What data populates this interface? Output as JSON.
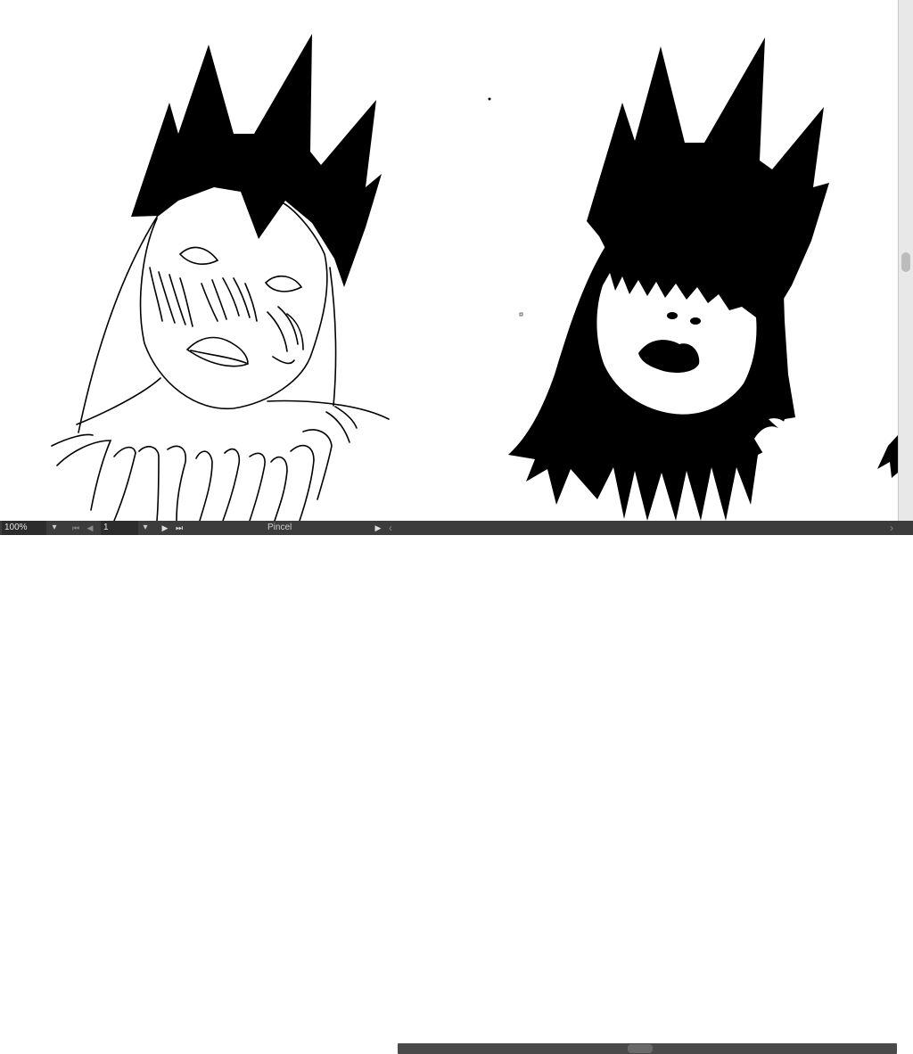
{
  "status_bar": {
    "zoom_value": "100%",
    "zoom_arrow": "▾",
    "artboard_first": "⏮",
    "artboard_prev": "◀",
    "artboard_number": "1",
    "artboard_arrow": "▾",
    "artboard_next": "▶",
    "artboard_last": "⏭",
    "current_tool": "Pincel",
    "status_arrow": "▶",
    "scroll_left_arrow": "‹",
    "scroll_right_arrow": "›"
  },
  "colors": {
    "ink": "#000000",
    "canvas": "#ffffff",
    "statusbar_bg": "#3c3c3c"
  }
}
